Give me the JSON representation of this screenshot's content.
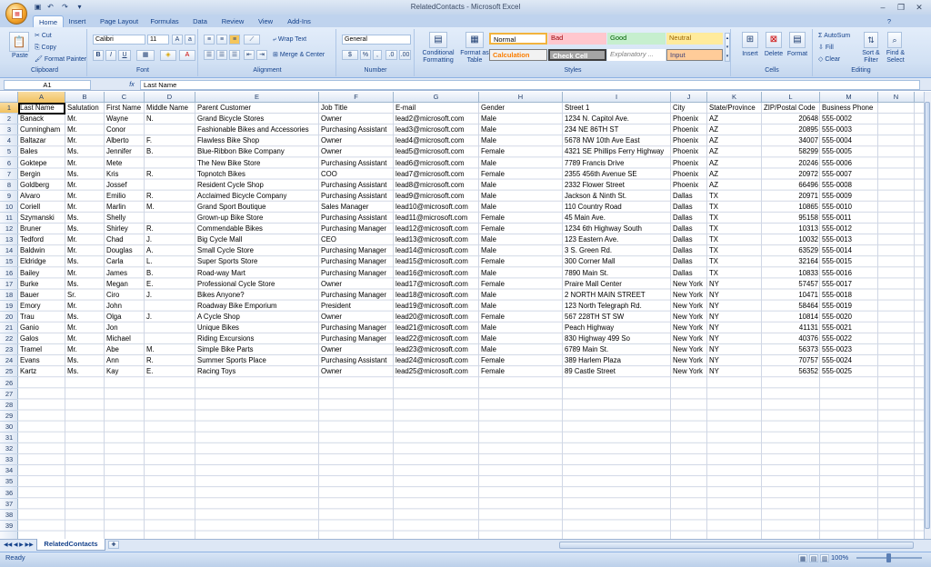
{
  "window": {
    "title": "RelatedContacts - Microsoft Excel"
  },
  "ribbon_tabs": [
    "Home",
    "Insert",
    "Page Layout",
    "Formulas",
    "Data",
    "Review",
    "View",
    "Add-Ins"
  ],
  "clipboard": {
    "paste": "Paste",
    "cut": "Cut",
    "copy": "Copy",
    "format_painter": "Format Painter",
    "label": "Clipboard"
  },
  "font": {
    "name": "Calibri",
    "size": "11",
    "label": "Font"
  },
  "alignment": {
    "wrap": "Wrap Text",
    "merge": "Merge & Center",
    "label": "Alignment"
  },
  "number": {
    "format": "General",
    "label": "Number"
  },
  "styles": {
    "cond": "Conditional Formatting",
    "table": "Format as Table",
    "normal": "Normal",
    "bad": "Bad",
    "good": "Good",
    "neutral": "Neutral",
    "calc": "Calculation",
    "check": "Check Cell",
    "explan": "Explanatory ...",
    "input": "Input",
    "label": "Styles"
  },
  "cells_group": {
    "insert": "Insert",
    "delete": "Delete",
    "format": "Format",
    "label": "Cells"
  },
  "editing": {
    "autosum": "AutoSum",
    "fill": "Fill",
    "clear": "Clear",
    "sort": "Sort & Filter",
    "find": "Find & Select",
    "label": "Editing"
  },
  "formula_bar": {
    "name_box": "A1",
    "fx": "fx",
    "content": "Last Name"
  },
  "columns": [
    "A",
    "B",
    "C",
    "D",
    "E",
    "F",
    "G",
    "H",
    "I",
    "J",
    "K",
    "L",
    "M",
    "N"
  ],
  "rows": 39,
  "header_row": [
    "Last Name",
    "Salutation",
    "First Name",
    "Middle Name",
    "Parent Customer",
    "Job Title",
    "E-mail",
    "Gender",
    "Street 1",
    "City",
    "State/Province",
    "ZIP/Postal Code",
    "Business Phone"
  ],
  "data_rows": [
    [
      "Banack",
      "Mr.",
      "Wayne",
      "N.",
      "Grand Bicycle Stores",
      "Owner",
      "lead2@microsoft.com",
      "Male",
      "1234 N. Capitol Ave.",
      "Phoenix",
      "AZ",
      "20648",
      "555-0002"
    ],
    [
      "Cunningham",
      "Mr.",
      "Conor",
      "",
      "Fashionable Bikes and Accessories",
      "Purchasing Assistant",
      "lead3@microsoft.com",
      "Male",
      "234 NE 86TH ST",
      "Phoenix",
      "AZ",
      "20895",
      "555-0003"
    ],
    [
      "Baltazar",
      "Mr.",
      "Alberto",
      "F.",
      "Flawless Bike Shop",
      "Owner",
      "lead4@microsoft.com",
      "Male",
      "5678 NW 10th Ave East",
      "Phoenix",
      "AZ",
      "34007",
      "555-0004"
    ],
    [
      "Bales",
      "Ms.",
      "Jennifer",
      "B.",
      "Blue-Ribbon Bike Company",
      "Owner",
      "lead5@microsoft.com",
      "Female",
      "4321 SE Phillips Ferry Highway",
      "Phoenix",
      "AZ",
      "58299",
      "555-0005"
    ],
    [
      "Goktepe",
      "Mr.",
      "Mete",
      "",
      "The New Bike Store",
      "Purchasing Assistant",
      "lead6@microsoft.com",
      "Male",
      "7789 Francis Drive",
      "Phoenix",
      "AZ",
      "20246",
      "555-0006"
    ],
    [
      "Bergin",
      "Ms.",
      "Kris",
      "R.",
      "Topnotch Bikes",
      "COO",
      "lead7@microsoft.com",
      "Female",
      "2355 456th Avenue SE",
      "Phoenix",
      "AZ",
      "20972",
      "555-0007"
    ],
    [
      "Goldberg",
      "Mr.",
      "Jossef",
      "",
      "Resident Cycle Shop",
      "Purchasing Assistant",
      "lead8@microsoft.com",
      "Male",
      "2332 Flower Street",
      "Phoenix",
      "AZ",
      "66496",
      "555-0008"
    ],
    [
      "Alvaro",
      "Mr.",
      "Emilio",
      "R.",
      "Acclaimed Bicycle Company",
      "Purchasing Assistant",
      "lead9@microsoft.com",
      "Male",
      "Jackson & Ninth St.",
      "Dallas",
      "TX",
      "20971",
      "555-0009"
    ],
    [
      "Coriell",
      "Mr.",
      "Marlin",
      "M.",
      "Grand Sport Boutique",
      "Sales Manager",
      "lead10@microsoft.com",
      "Male",
      "110 Country Road",
      "Dallas",
      "TX",
      "10865",
      "555-0010"
    ],
    [
      "Szymanski",
      "Ms.",
      "Shelly",
      "",
      "Grown-up Bike Store",
      "Purchasing Assistant",
      "lead11@microsoft.com",
      "Female",
      "45 Main Ave.",
      "Dallas",
      "TX",
      "95158",
      "555-0011"
    ],
    [
      "Bruner",
      "Ms.",
      "Shirley",
      "R.",
      "Commendable Bikes",
      "Purchasing Manager",
      "lead12@microsoft.com",
      "Female",
      "1234 6th Highway South",
      "Dallas",
      "TX",
      "10313",
      "555-0012"
    ],
    [
      "Tedford",
      "Mr.",
      "Chad",
      "J.",
      "Big Cycle Mall",
      "CEO",
      "lead13@microsoft.com",
      "Male",
      "123 Eastern Ave.",
      "Dallas",
      "TX",
      "10032",
      "555-0013"
    ],
    [
      "Baldwin",
      "Mr.",
      "Douglas",
      "A.",
      "Small Cycle Store",
      "Purchasing Manager",
      "lead14@microsoft.com",
      "Male",
      "3 S. Green Rd.",
      "Dallas",
      "TX",
      "63529",
      "555-0014"
    ],
    [
      "Eldridge",
      "Ms.",
      "Carla",
      "L.",
      "Super Sports Store",
      "Purchasing Manager",
      "lead15@microsoft.com",
      "Female",
      "300 Corner Mall",
      "Dallas",
      "TX",
      "32164",
      "555-0015"
    ],
    [
      "Bailey",
      "Mr.",
      "James",
      "B.",
      "Road-way Mart",
      "Purchasing Manager",
      "lead16@microsoft.com",
      "Male",
      "7890 Main St.",
      "Dallas",
      "TX",
      "10833",
      "555-0016"
    ],
    [
      "Burke",
      "Ms.",
      "Megan",
      "E.",
      "Professional Cycle Store",
      "Owner",
      "lead17@microsoft.com",
      "Female",
      "Praire Mall Center",
      "New York",
      "NY",
      "57457",
      "555-0017"
    ],
    [
      "Bauer",
      "Sr.",
      "Ciro",
      "J.",
      "Bikes Anyone?",
      "Purchasing Manager",
      "lead18@microsoft.com",
      "Male",
      "2 NORTH MAIN STREET",
      "New York",
      "NY",
      "10471",
      "555-0018"
    ],
    [
      "Emory",
      "Mr.",
      "John",
      "",
      "Roadway Bike Emporium",
      "President",
      "lead19@microsoft.com",
      "Male",
      "123 North Telegraph Rd.",
      "New York",
      "NY",
      "58464",
      "555-0019"
    ],
    [
      "Trau",
      "Ms.",
      "Olga",
      "J.",
      "A Cycle Shop",
      "Owner",
      "lead20@microsoft.com",
      "Female",
      "567 228TH ST SW",
      "New York",
      "NY",
      "10814",
      "555-0020"
    ],
    [
      "Ganio",
      "Mr.",
      "Jon",
      "",
      "Unique Bikes",
      "Purchasing Manager",
      "lead21@microsoft.com",
      "Male",
      "Peach Highway",
      "New York",
      "NY",
      "41131",
      "555-0021"
    ],
    [
      "Galos",
      "Mr.",
      "Michael",
      "",
      "Riding Excursions",
      "Purchasing Manager",
      "lead22@microsoft.com",
      "Male",
      "830 Highway 499 So",
      "New York",
      "NY",
      "40376",
      "555-0022"
    ],
    [
      "Tramel",
      "Mr.",
      "Abe",
      "M.",
      "Simple Bike Parts",
      "Owner",
      "lead23@microsoft.com",
      "Male",
      "6789 Main St.",
      "New York",
      "NY",
      "56373",
      "555-0023"
    ],
    [
      "Evans",
      "Ms.",
      "Ann",
      "R.",
      "Summer Sports Place",
      "Purchasing Assistant",
      "lead24@microsoft.com",
      "Female",
      "389 Harlem Plaza",
      "New York",
      "NY",
      "70757",
      "555-0024"
    ],
    [
      "Kartz",
      "Ms.",
      "Kay",
      "E.",
      "Racing Toys",
      "Owner",
      "lead25@microsoft.com",
      "Female",
      "89 Castle Street",
      "New York",
      "NY",
      "56352",
      "555-0025"
    ]
  ],
  "sheet_tab": "RelatedContacts",
  "status": {
    "ready": "Ready",
    "zoom": "100%"
  },
  "colors": {
    "accent": "#15428b",
    "selection": "#f1c15f",
    "grid": "#d0d7e5"
  }
}
